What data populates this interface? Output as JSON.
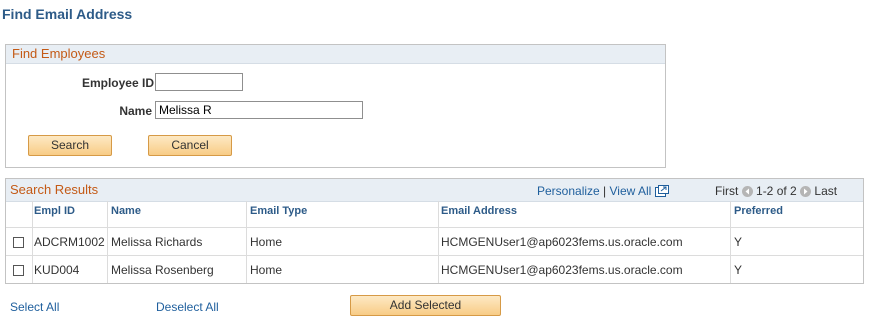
{
  "page": {
    "title": "Find Email Address"
  },
  "find_employees": {
    "header": "Find Employees",
    "employee_id": {
      "label": "Employee ID",
      "value": ""
    },
    "name": {
      "label": "Name",
      "value": "Melissa R"
    },
    "search_button": "Search",
    "cancel_button": "Cancel"
  },
  "results": {
    "header": "Search Results",
    "personalize": "Personalize",
    "separator": "|",
    "view_all": "View All",
    "first": "First",
    "range": "1-2 of 2",
    "last": "Last",
    "columns": [
      "Empl ID",
      "Name",
      "Email Type",
      "Email Address",
      "Preferred"
    ],
    "rows": [
      {
        "empl_id": "ADCRM1002",
        "name": "Melissa Richards",
        "email_type": "Home",
        "email": "HCMGENUser1@ap6023fems.us.oracle.com",
        "preferred": "Y",
        "checked": false
      },
      {
        "empl_id": "KUD004",
        "name": "Melissa Rosenberg",
        "email_type": "Home",
        "email": "HCMGENUser1@ap6023fems.us.oracle.com",
        "preferred": "Y",
        "checked": false
      }
    ]
  },
  "footer": {
    "select_all": "Select All",
    "deselect_all": "Deselect All",
    "add_selected": "Add Selected"
  },
  "icons": {
    "grid_view": "grid-window-icon",
    "first": "arrow-left-circle-icon",
    "last": "arrow-right-circle-icon"
  },
  "colors": {
    "title": "#2d5b88",
    "group_label": "#c45a16",
    "link": "#1f5f9d",
    "button_fill": "#f8cc86",
    "button_border": "#d69a46",
    "header_band": "#e8eef4"
  }
}
